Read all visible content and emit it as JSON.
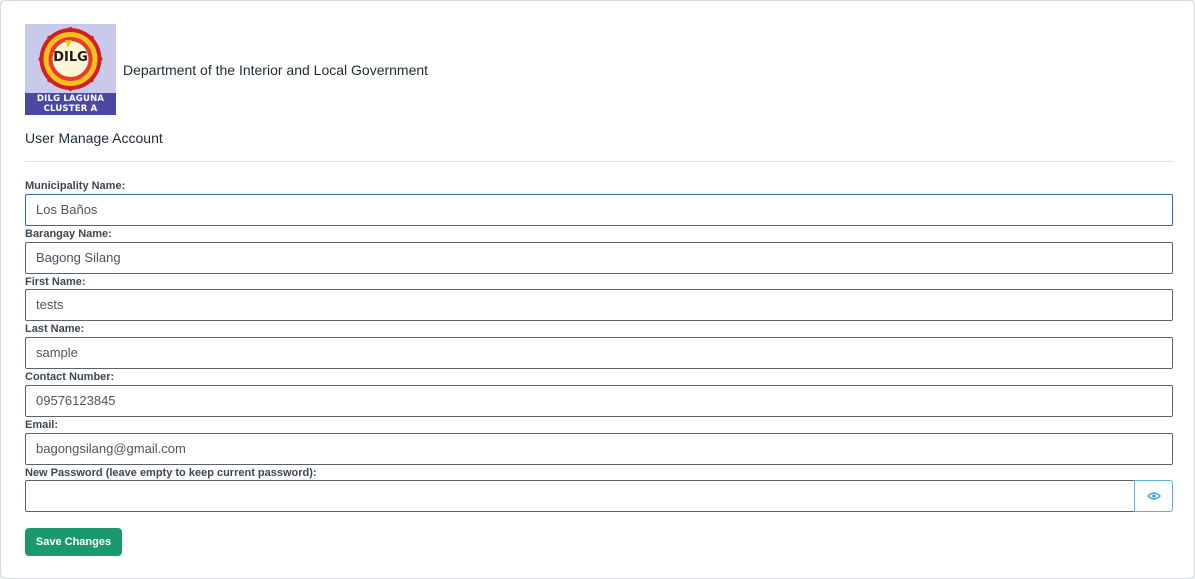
{
  "header": {
    "logo_text": "DILG",
    "logo_band_line1": "DILG LAGUNA",
    "logo_band_line2": "CLUSTER A",
    "org_name": "Department of the Interior and Local Government"
  },
  "page_title": "User Manage Account",
  "form": {
    "municipality": {
      "label": "Municipality Name:",
      "value": "Los Baños"
    },
    "barangay": {
      "label": "Barangay Name:",
      "value": "Bagong Silang"
    },
    "first_name": {
      "label": "First Name:",
      "value": "tests"
    },
    "last_name": {
      "label": "Last Name:",
      "value": "sample"
    },
    "contact": {
      "label": "Contact Number:",
      "value": "09576123845"
    },
    "email": {
      "label": "Email:",
      "value": "bagongsilang@gmail.com"
    },
    "password": {
      "label": "New Password (leave empty to keep current password):",
      "value": ""
    },
    "show_password_icon": "eye-icon",
    "save_label": "Save Changes"
  },
  "colors": {
    "accent_green": "#1a9a6c",
    "eye_blue": "#5bb5e0",
    "logo_band": "#4a4aa0"
  }
}
